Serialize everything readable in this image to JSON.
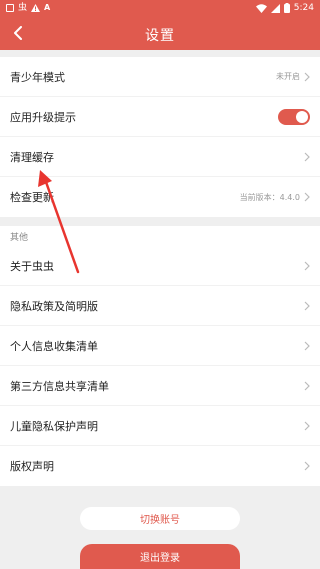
{
  "status_bar": {
    "left_icons": [
      "square-icon",
      "chong-icon",
      "warning-icon",
      "a-icon"
    ],
    "chong_glyph": "虫",
    "a_glyph": "A",
    "time": "5:24"
  },
  "header": {
    "title": "设置",
    "back_icon": "chevron-left-icon"
  },
  "settings": {
    "rows": [
      {
        "label": "青少年模式",
        "value": "未开启"
      },
      {
        "label": "应用升级提示",
        "toggle_on": true
      },
      {
        "label": "清理缓存"
      },
      {
        "label": "检查更新",
        "value": "当前版本：4.4.0"
      }
    ]
  },
  "other": {
    "section_title": "其他",
    "rows": [
      {
        "label": "关于虫虫"
      },
      {
        "label": "隐私政策及简明版"
      },
      {
        "label": "个人信息收集清单"
      },
      {
        "label": "第三方信息共享清单"
      },
      {
        "label": "儿童隐私保护声明"
      },
      {
        "label": "版权声明"
      }
    ]
  },
  "actions": {
    "switch_account": "切换账号",
    "logout": "退出登录"
  },
  "colors": {
    "accent": "#e05a4e",
    "annotation_arrow": "#e8352f"
  }
}
